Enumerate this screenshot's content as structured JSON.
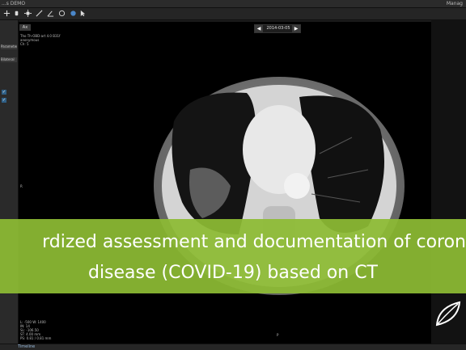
{
  "app": {
    "title": "...s DEMO",
    "top_right": "Manag"
  },
  "toolbar": {
    "icons": [
      "pan-icon",
      "move-icon",
      "brightness-icon",
      "measure-icon",
      "angle-icon",
      "crosshair-icon",
      "cursor-icon"
    ]
  },
  "left_panel": {
    "item_1": "Parameters",
    "item_2": "Bilateral"
  },
  "viewer": {
    "tab_label": "Ax",
    "date": "2014-03-05",
    "prev_label": "◀",
    "next_label": "▶",
    "overlay_top_left": [
      "Tho  Th-OBD-art 4.0 B31f",
      "anonymous",
      "Ch: 5"
    ],
    "overlay_bottom_left": [
      "L: -500 W: 1400",
      "IN: 14",
      "SL: -106.50",
      "ST: 4.00 mm",
      "PS: 0.81 / 0.81 mm"
    ],
    "orient_left": "R",
    "orient_bottom": "P"
  },
  "banner": {
    "line1": "rdized assessment and documentation of coron",
    "line2": "disease (COVID-19) based on CT"
  },
  "status": {
    "label": "Timeline"
  },
  "colors": {
    "banner": "#8dbb34",
    "background": "#1b1b1b"
  }
}
